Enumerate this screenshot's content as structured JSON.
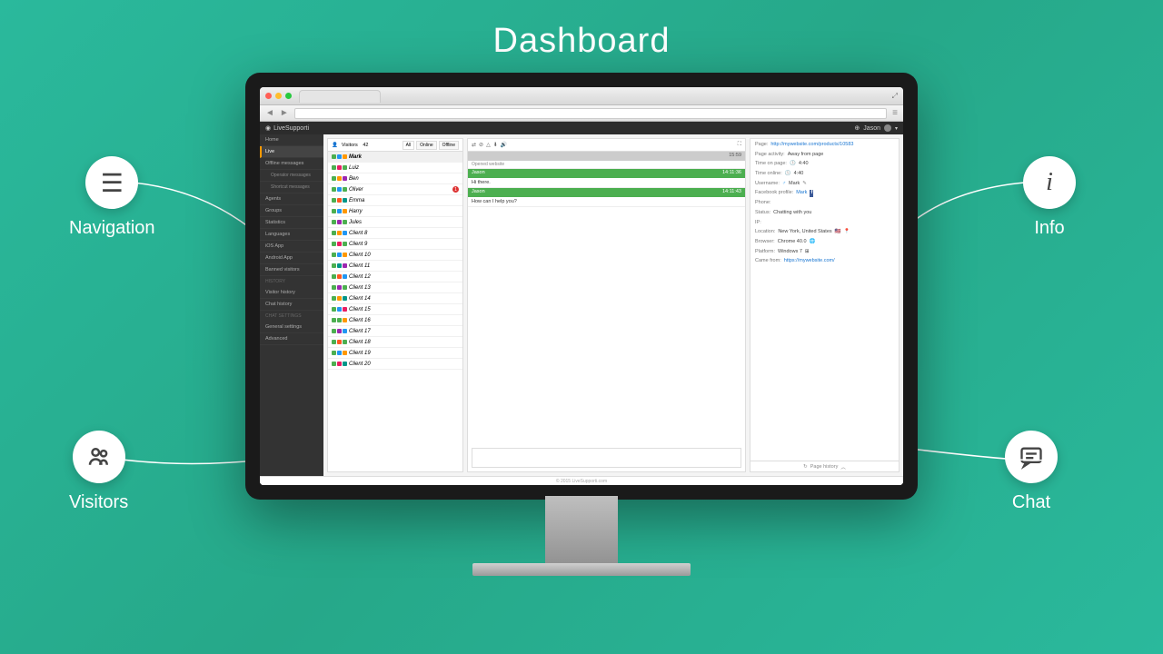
{
  "title": "Dashboard",
  "callouts": {
    "navigation": "Navigation",
    "info": "Info",
    "visitors": "Visitors",
    "chat": "Chat"
  },
  "app": {
    "brand": "LiveSupporti",
    "user": "Jason",
    "footer": "© 2015 LiveSupporti.com"
  },
  "sidebar": {
    "items": [
      {
        "label": "Home",
        "type": "item"
      },
      {
        "label": "Live",
        "type": "item",
        "active": true
      },
      {
        "label": "Offline messages",
        "type": "item"
      },
      {
        "label": "Operator messages",
        "type": "sub"
      },
      {
        "label": "Shortcut messages",
        "type": "sub"
      },
      {
        "label": "Agents",
        "type": "item"
      },
      {
        "label": "Groups",
        "type": "item"
      },
      {
        "label": "Statistics",
        "type": "item"
      },
      {
        "label": "Languages",
        "type": "item"
      },
      {
        "label": "iOS App",
        "type": "item"
      },
      {
        "label": "Android App",
        "type": "item"
      },
      {
        "label": "Banned visitors",
        "type": "item"
      },
      {
        "label": "HISTORY",
        "type": "cat"
      },
      {
        "label": "Visitor history",
        "type": "item"
      },
      {
        "label": "Chat history",
        "type": "item"
      },
      {
        "label": "CHAT SETTINGS",
        "type": "cat"
      },
      {
        "label": "General settings",
        "type": "item"
      },
      {
        "label": "Advanced",
        "type": "item"
      }
    ]
  },
  "visitors": {
    "label": "Visitors",
    "count": "42",
    "filters": {
      "all": "All",
      "online": "Online",
      "offline": "Offline"
    },
    "rows": [
      {
        "name": "Mark",
        "c1": "#4caf50",
        "c2": "#2196f3",
        "c3": "#ff9800",
        "active": true
      },
      {
        "name": "Luiz",
        "c1": "#4caf50",
        "c2": "#e91e63",
        "c3": "#4caf50"
      },
      {
        "name": "Ben",
        "c1": "#4caf50",
        "c2": "#ff9800",
        "c3": "#9c27b0"
      },
      {
        "name": "Oliver",
        "c1": "#4caf50",
        "c2": "#2196f3",
        "c3": "#4caf50",
        "badge": "1"
      },
      {
        "name": "Emma",
        "c1": "#4caf50",
        "c2": "#ff5722",
        "c3": "#009688"
      },
      {
        "name": "Harry",
        "c1": "#4caf50",
        "c2": "#2196f3",
        "c3": "#ff9800"
      },
      {
        "name": "Jules",
        "c1": "#4caf50",
        "c2": "#9c27b0",
        "c3": "#4caf50"
      },
      {
        "name": "Client 8",
        "c1": "#4caf50",
        "c2": "#ff9800",
        "c3": "#2196f3"
      },
      {
        "name": "Client 9",
        "c1": "#4caf50",
        "c2": "#e91e63",
        "c3": "#4caf50"
      },
      {
        "name": "Client 10",
        "c1": "#4caf50",
        "c2": "#2196f3",
        "c3": "#ff9800"
      },
      {
        "name": "Client 11",
        "c1": "#4caf50",
        "c2": "#009688",
        "c3": "#9c27b0"
      },
      {
        "name": "Client 12",
        "c1": "#4caf50",
        "c2": "#ff5722",
        "c3": "#2196f3"
      },
      {
        "name": "Client 13",
        "c1": "#4caf50",
        "c2": "#9c27b0",
        "c3": "#4caf50"
      },
      {
        "name": "Client 14",
        "c1": "#4caf50",
        "c2": "#ff9800",
        "c3": "#009688"
      },
      {
        "name": "Client 15",
        "c1": "#4caf50",
        "c2": "#2196f3",
        "c3": "#e91e63"
      },
      {
        "name": "Client 16",
        "c1": "#4caf50",
        "c2": "#4caf50",
        "c3": "#ff9800"
      },
      {
        "name": "Client 17",
        "c1": "#4caf50",
        "c2": "#9c27b0",
        "c3": "#2196f3"
      },
      {
        "name": "Client 18",
        "c1": "#4caf50",
        "c2": "#ff5722",
        "c3": "#4caf50"
      },
      {
        "name": "Client 19",
        "c1": "#4caf50",
        "c2": "#2196f3",
        "c3": "#ff9800"
      },
      {
        "name": "Client 20",
        "c1": "#4caf50",
        "c2": "#e91e63",
        "c3": "#009688"
      }
    ]
  },
  "chat": {
    "status_time": "15:59",
    "opened": "Opened website",
    "msg1_name": "Jason",
    "msg1_time": "14:11:36",
    "msg1_text": "Hi there.",
    "msg2_name": "Jason",
    "msg2_time": "14:11:43",
    "msg2_text": "How can I help you?"
  },
  "info": {
    "page_label": "Page:",
    "page_value": "http://mywebsite.com/products/10583",
    "activity_label": "Page activity:",
    "activity_value": "Away from page",
    "timepage_label": "Time on page:",
    "timepage_value": "4:40",
    "timeonline_label": "Time online:",
    "timeonline_value": "4:40",
    "username_label": "Username:",
    "username_value": "Mark",
    "fb_label": "Facebook profile:",
    "fb_value": "Mark",
    "phone_label": "Phone:",
    "status_label": "Status:",
    "status_value": "Chatting with you",
    "ip_label": "IP:",
    "location_label": "Location:",
    "location_value": "New York, United States",
    "browser_label": "Browser:",
    "browser_value": "Chrome 40.0",
    "platform_label": "Platform:",
    "platform_value": "Windows 7",
    "camefrom_label": "Came from:",
    "camefrom_value": "https://mywebsite.com/",
    "footer": "Page history"
  }
}
